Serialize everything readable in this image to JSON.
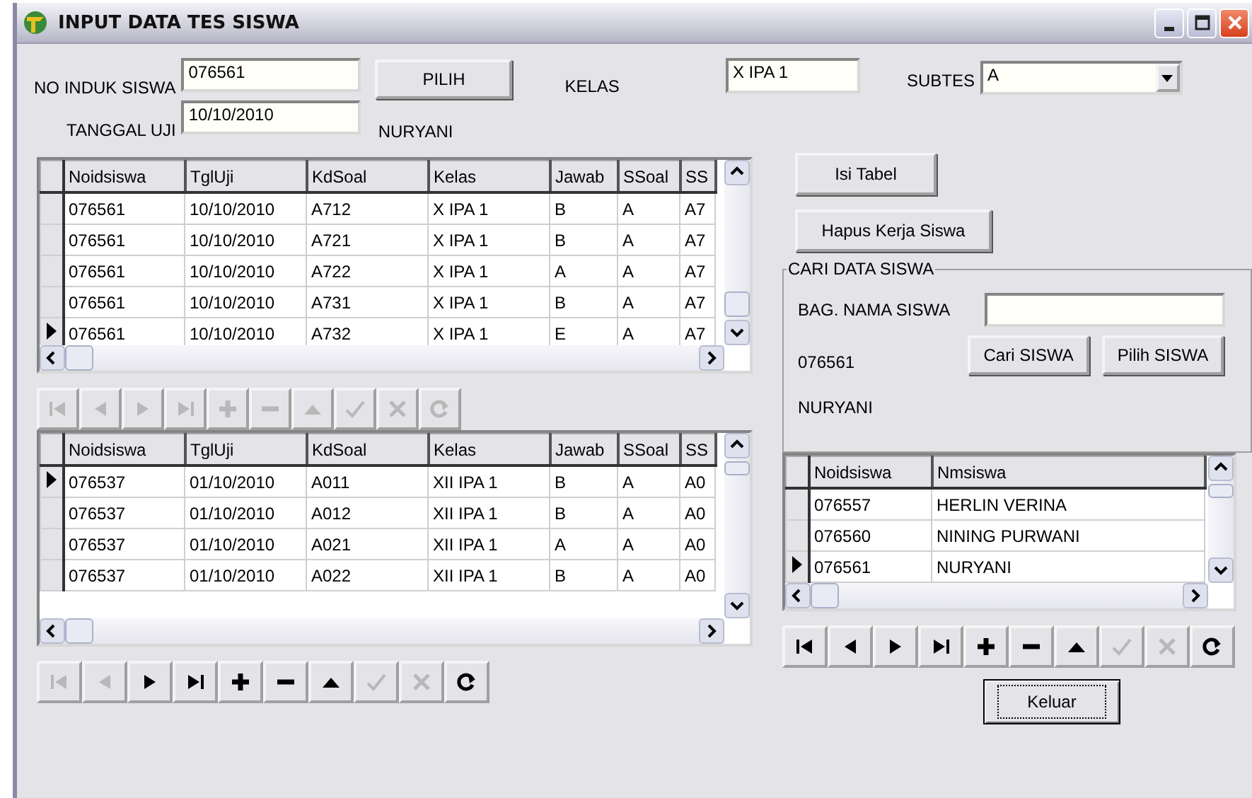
{
  "window": {
    "title": "INPUT DATA TES SISWA"
  },
  "header": {
    "no_induk_label": "NO INDUK SISWA",
    "no_induk_value": "076561",
    "pilih_button": "PILIH",
    "kelas_label": "KELAS",
    "kelas_value": "X IPA 1",
    "subtes_label": "SUBTES",
    "subtes_value": "A",
    "tanggal_label": "TANGGAL UJI",
    "tanggal_value": "10/10/2010",
    "student_name": "NURYANI"
  },
  "answer_grid": {
    "columns": [
      "Noidsiswa",
      "TglUji",
      "KdSoal",
      "Kelas",
      "Jawab",
      "SSoal",
      "SS"
    ],
    "rows": [
      {
        "selected": false,
        "cells": [
          "076561",
          "10/10/2010",
          "A712",
          "X IPA 1",
          "B",
          "A",
          "A7"
        ]
      },
      {
        "selected": false,
        "cells": [
          "076561",
          "10/10/2010",
          "A721",
          "X IPA 1",
          "B",
          "A",
          "A7"
        ]
      },
      {
        "selected": false,
        "cells": [
          "076561",
          "10/10/2010",
          "A722",
          "X IPA 1",
          "A",
          "A",
          "A7"
        ]
      },
      {
        "selected": false,
        "cells": [
          "076561",
          "10/10/2010",
          "A731",
          "X IPA 1",
          "B",
          "A",
          "A7"
        ]
      },
      {
        "selected": true,
        "cells": [
          "076561",
          "10/10/2010",
          "A732",
          "X IPA 1",
          "E",
          "A",
          "A7"
        ]
      }
    ]
  },
  "answer_navigator": [
    {
      "kind": "first",
      "disabled": true
    },
    {
      "kind": "prior",
      "disabled": true
    },
    {
      "kind": "next",
      "disabled": true
    },
    {
      "kind": "last",
      "disabled": true
    },
    {
      "kind": "insert",
      "disabled": true
    },
    {
      "kind": "delete",
      "disabled": true
    },
    {
      "kind": "edit",
      "disabled": true
    },
    {
      "kind": "post",
      "disabled": true
    },
    {
      "kind": "cancel",
      "disabled": true
    },
    {
      "kind": "refresh",
      "disabled": true
    }
  ],
  "history_grid": {
    "columns": [
      "Noidsiswa",
      "TglUji",
      "KdSoal",
      "Kelas",
      "Jawab",
      "SSoal",
      "SS"
    ],
    "rows": [
      {
        "selected": true,
        "cells": [
          "076537",
          "01/10/2010",
          "A011",
          "XII IPA 1",
          "B",
          "A",
          "A0"
        ]
      },
      {
        "selected": false,
        "cells": [
          "076537",
          "01/10/2010",
          "A012",
          "XII IPA 1",
          "B",
          "A",
          "A0"
        ]
      },
      {
        "selected": false,
        "cells": [
          "076537",
          "01/10/2010",
          "A021",
          "XII IPA 1",
          "A",
          "A",
          "A0"
        ]
      },
      {
        "selected": false,
        "cells": [
          "076537",
          "01/10/2010",
          "A022",
          "XII IPA 1",
          "B",
          "A",
          "A0"
        ]
      }
    ]
  },
  "history_navigator": [
    {
      "kind": "first",
      "disabled": true
    },
    {
      "kind": "prior",
      "disabled": true
    },
    {
      "kind": "next",
      "disabled": false
    },
    {
      "kind": "last",
      "disabled": false
    },
    {
      "kind": "insert",
      "disabled": false
    },
    {
      "kind": "delete",
      "disabled": false
    },
    {
      "kind": "edit",
      "disabled": false
    },
    {
      "kind": "post",
      "disabled": true
    },
    {
      "kind": "cancel",
      "disabled": true
    },
    {
      "kind": "refresh",
      "disabled": false
    }
  ],
  "isi_tabel_button": "Isi Tabel",
  "hapus_button": "Hapus Kerja Siswa",
  "search_group": {
    "title": "CARI DATA SISWA",
    "name_label": "BAG. NAMA SISWA",
    "cari_button": "Cari SISWA",
    "pilih_button": "Pilih SISWA",
    "found_id": "076561",
    "found_name": "NURYANI"
  },
  "student_grid": {
    "columns": [
      "Noidsiswa",
      "Nmsiswa"
    ],
    "rows": [
      {
        "selected": false,
        "cells": [
          "076557",
          "HERLIN VERINA"
        ]
      },
      {
        "selected": false,
        "cells": [
          "076560",
          "NINING PURWANI"
        ]
      },
      {
        "selected": true,
        "cells": [
          "076561",
          "NURYANI"
        ]
      }
    ]
  },
  "student_navigator": [
    {
      "kind": "first",
      "disabled": false
    },
    {
      "kind": "prior",
      "disabled": false
    },
    {
      "kind": "next",
      "disabled": false
    },
    {
      "kind": "last",
      "disabled": false
    },
    {
      "kind": "insert",
      "disabled": false
    },
    {
      "kind": "delete",
      "disabled": false
    },
    {
      "kind": "edit",
      "disabled": false
    },
    {
      "kind": "post",
      "disabled": true
    },
    {
      "kind": "cancel",
      "disabled": true
    },
    {
      "kind": "refresh",
      "disabled": false
    }
  ],
  "exit_button": "Keluar"
}
